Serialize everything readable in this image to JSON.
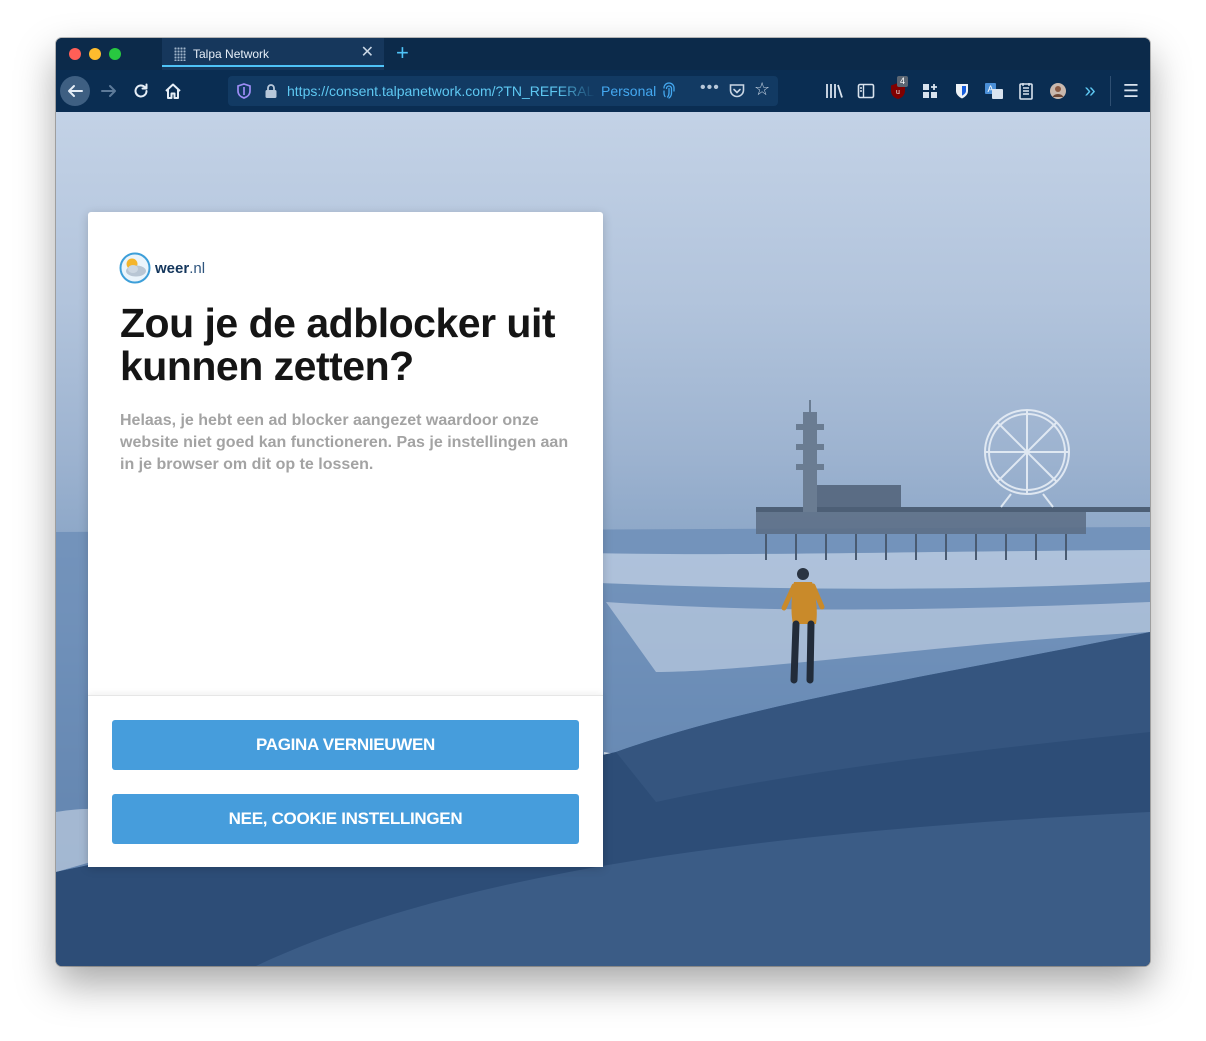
{
  "browser": {
    "tab_title": "Talpa Network",
    "tab_close": "✕",
    "new_tab": "+",
    "url": "https://consent.talpanetwork.com/?TN_REFERAL",
    "container_label": "Personal",
    "page_actions": "•••",
    "bookmark_star": "☆",
    "more_tools": "»",
    "menu": "☰",
    "ublock_badge": "4"
  },
  "dialog": {
    "logo_name": "weer",
    "logo_tld": ".nl",
    "title": "Zou je de adblocker uit kunnen zetten?",
    "description": "Helaas, je hebt een ad blocker aangezet waardoor onze website niet goed kan functioneren. Pas je instellingen aan in je browser om dit op te lossen.",
    "refresh_button": "PAGINA VERNIEUWEN",
    "cookie_button": "NEE, COOKIE INSTELLINGEN"
  },
  "colors": {
    "primary_button": "#469ddc",
    "toolbar": "#0a2d52",
    "url_text": "#5ec8f2",
    "container": "#44a8f0"
  }
}
